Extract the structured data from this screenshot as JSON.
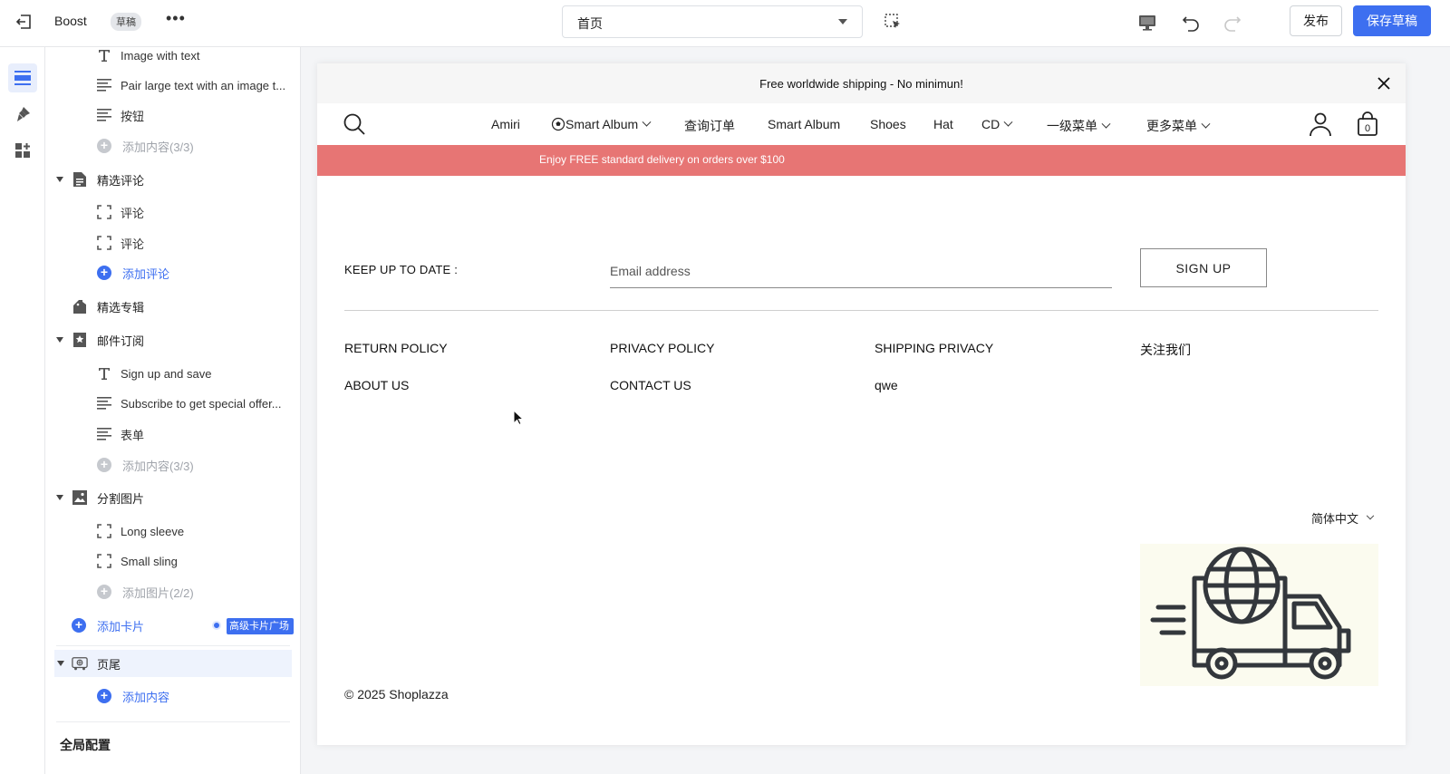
{
  "topbar": {
    "app_name": "Boost",
    "status_badge": "草稿",
    "more_label": "•••",
    "page_select_value": "首页",
    "publish_label": "发布",
    "save_draft_label": "保存草稿"
  },
  "sidebar": {
    "items": [
      {
        "label": "Image with text",
        "icon": "text-icon"
      },
      {
        "label": "Pair large text with an image t...",
        "icon": "paragraph-icon"
      },
      {
        "label": "按钮",
        "icon": "paragraph-icon"
      },
      {
        "label": "添加内容(3/3)",
        "icon": "add-icon"
      },
      {
        "label": "精选评论",
        "icon": "document-icon"
      },
      {
        "label": "评论",
        "icon": "block-icon"
      },
      {
        "label": "评论",
        "icon": "block-icon"
      },
      {
        "label": "添加评论",
        "icon": "add-icon"
      },
      {
        "label": "精选专辑",
        "icon": "collection-icon"
      },
      {
        "label": "邮件订阅",
        "icon": "star-bookmark-icon"
      },
      {
        "label": "Sign up and save",
        "icon": "text-icon"
      },
      {
        "label": "Subscribe to get special offer...",
        "icon": "paragraph-icon"
      },
      {
        "label": "表单",
        "icon": "paragraph-icon"
      },
      {
        "label": "添加内容(3/3)",
        "icon": "add-icon"
      },
      {
        "label": "分割图片",
        "icon": "image-icon"
      },
      {
        "label": "Long sleeve",
        "icon": "block-icon"
      },
      {
        "label": "Small sling",
        "icon": "block-icon"
      },
      {
        "label": "添加图片(2/2)",
        "icon": "add-icon"
      },
      {
        "label": "添加卡片",
        "icon": "add-icon"
      },
      {
        "label": "页尾",
        "icon": "footer-icon"
      },
      {
        "label": "添加内容",
        "icon": "add-icon"
      }
    ],
    "pro_tag": "高级卡片广场",
    "global_config": "全局配置"
  },
  "preview": {
    "announcement": "Free worldwide shipping - No minimun!",
    "nav": [
      "Amiri",
      "Smart Album",
      "查询订单",
      "Smart Album",
      "Shoes",
      "Hat",
      "CD",
      "一级菜单",
      "更多菜单"
    ],
    "cart_count": "0",
    "promo": "Enjoy FREE standard delivery on orders over $100",
    "newsletter_label": "KEEP UP TO DATE :",
    "email_placeholder": "Email address",
    "signup_label": "SIGN UP",
    "links": {
      "return_policy": "RETURN POLICY",
      "privacy_policy": "PRIVACY POLICY",
      "shipping_privacy": "SHIPPING PRIVACY",
      "follow_us": "关注我们",
      "about_us": "ABOUT US",
      "contact_us": "CONTACT US",
      "qwe": "qwe"
    },
    "language": "简体中文",
    "copyright": "© 2025 Shoplazza"
  },
  "colors": {
    "accent": "#3d6ff0",
    "promo_bg": "#e77574",
    "announcement_bg": "#f6f6f6"
  }
}
